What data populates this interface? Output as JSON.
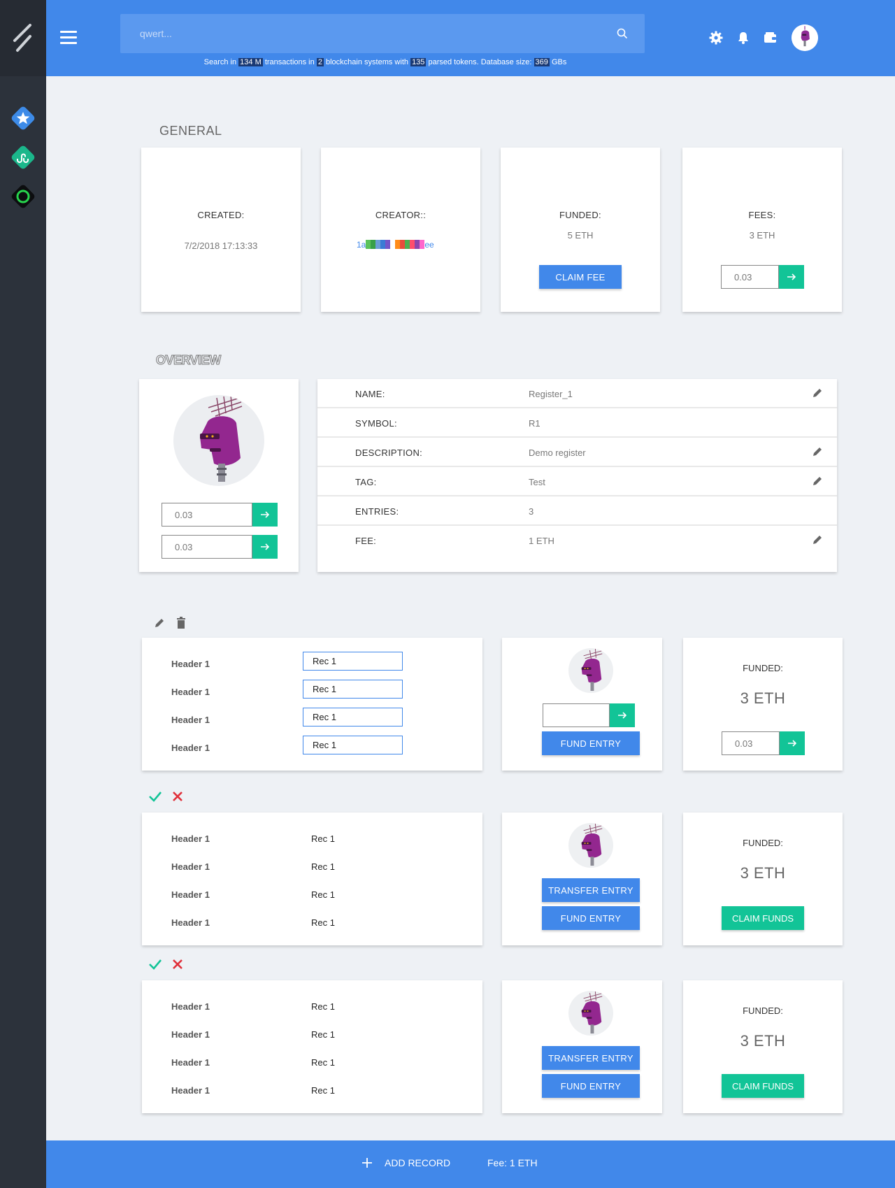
{
  "header": {
    "search_placeholder": "qwert...",
    "stats": {
      "p1": "Search in",
      "tx_count": "134 M",
      "p2": "transactions in",
      "chains": "2",
      "p3": "blockchain systems with",
      "tokens": "135",
      "p4": "parsed tokens. Database size:",
      "db_size": "369",
      "p5": "GBs"
    },
    "icons": [
      "settings-icon",
      "bell-icon",
      "wallet-icon",
      "avatar"
    ]
  },
  "sidebar": {
    "apps": [
      "star-app-icon",
      "stumbleupon-app-icon",
      "ring-app-icon"
    ]
  },
  "general": {
    "title": "GENERAL",
    "created_label": "CREATED:",
    "created_value": "7/2/2018 17:13:33",
    "creator_label": "CREATOR::",
    "creator_prefix": "1a",
    "creator_suffix": "ee",
    "creator_colors": [
      "#5cc35b",
      "#38a04a",
      "#6b9ed8",
      "#3a7bd5",
      "#7455c8",
      "#ffffff",
      "#ff8c1a",
      "#e74c3c",
      "#4caf50",
      "#ff4d6d",
      "#8e44ad",
      "#ff66cc"
    ],
    "funded_label": "FUNDED:",
    "funded_value": "5 ETH",
    "claim_fee_label": "CLAIM FEE",
    "fees_label": "FEES:",
    "fees_value": "3 ETH",
    "fees_input": "0.03"
  },
  "overview": {
    "title": "OVERVIEW",
    "input1": "0.03",
    "input2": "0.03",
    "rows": [
      {
        "key": "NAME:",
        "value": "Register_1",
        "editable": true
      },
      {
        "key": "SYMBOL:",
        "value": "R1",
        "editable": false
      },
      {
        "key": "DESCRIPTION:",
        "value": "Demo register",
        "editable": true
      },
      {
        "key": "TAG:",
        "value": "Test",
        "editable": true
      },
      {
        "key": "ENTRIES:",
        "value": "3",
        "editable": false
      },
      {
        "key": "FEE:",
        "value": "1 ETH",
        "editable": true
      }
    ]
  },
  "entries": [
    {
      "mode": "edit",
      "fields": [
        {
          "header": "Header 1",
          "value": "Rec 1"
        },
        {
          "header": "Header 1",
          "value": "Rec 1"
        },
        {
          "header": "Header 1",
          "value": "Rec 1"
        },
        {
          "header": "Header 1",
          "value": "Rec 1"
        }
      ],
      "fund_input": "",
      "fund_entry_label": "FUND ENTRY",
      "funded_label": "FUNDED:",
      "funded_value": "3 ETH",
      "funded_input": "0.03"
    },
    {
      "mode": "view",
      "fields": [
        {
          "header": "Header 1",
          "value": "Rec 1"
        },
        {
          "header": "Header 1",
          "value": "Rec 1"
        },
        {
          "header": "Header 1",
          "value": "Rec 1"
        },
        {
          "header": "Header 1",
          "value": "Rec 1"
        }
      ],
      "transfer_entry_label": "TRANSFER ENTRY",
      "fund_entry_label": "FUND ENTRY",
      "funded_label": "FUNDED:",
      "funded_value": "3 ETH",
      "claim_funds_label": "CLAIM FUNDS"
    },
    {
      "mode": "view",
      "fields": [
        {
          "header": "Header 1",
          "value": "Rec 1"
        },
        {
          "header": "Header 1",
          "value": "Rec 1"
        },
        {
          "header": "Header 1",
          "value": "Rec 1"
        },
        {
          "header": "Header 1",
          "value": "Rec 1"
        }
      ],
      "transfer_entry_label": "TRANSFER ENTRY",
      "fund_entry_label": "FUND ENTRY",
      "funded_label": "FUNDED:",
      "funded_value": "3 ETH",
      "claim_funds_label": "CLAIM FUNDS"
    }
  ],
  "footer": {
    "add_record_label": "ADD RECORD",
    "fee_label": "Fee: 1 ETH"
  },
  "colors": {
    "primary": "#4188ea",
    "accent": "#12c497",
    "sidebar": "#2c323b",
    "confirm": "#12c497",
    "cancel": "#e0303a"
  }
}
